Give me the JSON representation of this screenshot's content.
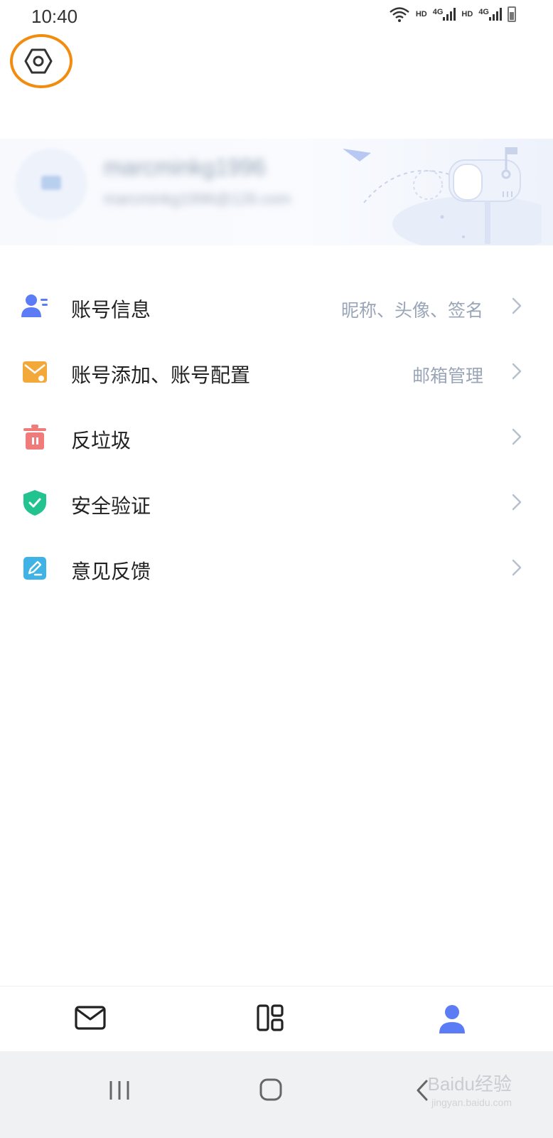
{
  "status_bar": {
    "time": "10:40",
    "hd1": "HD",
    "net1": "4G",
    "hd2": "HD",
    "net2": "4G"
  },
  "header": {
    "settings_icon": "settings-hexagon-icon",
    "highlight_color": "#f28c0f"
  },
  "profile": {
    "name": "marcminkg1996",
    "email": "marcminkg1996@126.com"
  },
  "menu": {
    "items": [
      {
        "label": "账号信息",
        "subtext": "昵称、头像、签名",
        "icon": "account-info-icon",
        "color": "#5b7cf5"
      },
      {
        "label": "账号添加、账号配置",
        "subtext": "邮箱管理",
        "icon": "mail-config-icon",
        "color": "#f3a93a"
      },
      {
        "label": "反垃圾",
        "subtext": "",
        "icon": "trash-icon",
        "color": "#f07b7b"
      },
      {
        "label": "安全验证",
        "subtext": "",
        "icon": "shield-check-icon",
        "color": "#22c38e"
      },
      {
        "label": "意见反馈",
        "subtext": "",
        "icon": "feedback-edit-icon",
        "color": "#3fb2e6"
      }
    ]
  },
  "tab_bar": {
    "tabs": [
      {
        "name": "mail",
        "icon": "mail-icon",
        "active": false
      },
      {
        "name": "apps",
        "icon": "apps-grid-icon",
        "active": false
      },
      {
        "name": "me",
        "icon": "person-icon",
        "active": true
      }
    ],
    "active_color": "#5b7cf5"
  },
  "nav_bar": {
    "watermark": "Baidu经验",
    "watermark_sub": "jingyan.baidu.com"
  }
}
